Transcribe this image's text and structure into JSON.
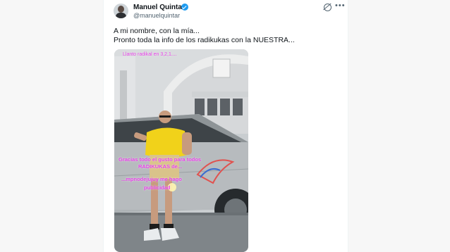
{
  "tweet": {
    "author": {
      "display_name": "Manuel Quintar",
      "handle": "@manuelquintar",
      "verified": true
    },
    "text_lines": [
      "A mi nombre, con la mía...",
      "Pronto toda la info de los radikukas con la NUESTRA..."
    ],
    "media": {
      "overlay_top": "Llanto radikal en 3,2,1....",
      "overlay_lines": [
        "Gracias todo el gusto para todos",
        "RADIKUKAS de...",
        "...mpnodejujuy me hago",
        "publicidad"
      ]
    }
  },
  "icons": [
    "verified-icon",
    "grok-icon",
    "more-icon"
  ],
  "colors": {
    "accent": "#1d9bf0",
    "overlay_text": "#e53fe6"
  }
}
